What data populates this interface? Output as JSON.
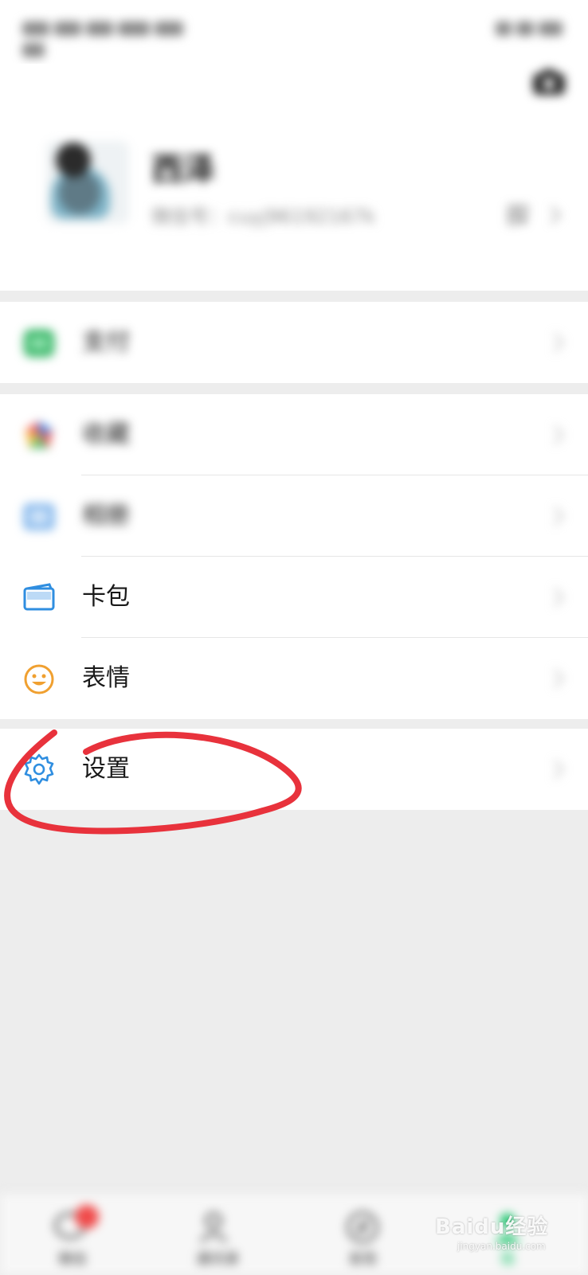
{
  "profile": {
    "nickname": "西泽",
    "wechat_id": "微信号：cuyj96192167k"
  },
  "menu": {
    "pay": {
      "label": "支付",
      "icon": "pay-icon"
    },
    "favorites": {
      "label": "收藏",
      "icon": "favorites-icon"
    },
    "moments": {
      "label": "相册",
      "icon": "album-icon"
    },
    "cards": {
      "label": "卡包",
      "icon": "card-wallet-icon"
    },
    "stickers": {
      "label": "表情",
      "icon": "smiley-icon"
    },
    "settings": {
      "label": "设置",
      "icon": "gear-icon"
    }
  },
  "tabbar": {
    "tabs": [
      {
        "label": "微信",
        "icon": "chat-icon",
        "badge": true
      },
      {
        "label": "通讯录",
        "icon": "contacts-icon"
      },
      {
        "label": "发现",
        "icon": "discover-icon"
      },
      {
        "label": "我",
        "icon": "me-icon",
        "active": true
      }
    ]
  },
  "watermark": {
    "main": "Baidu经验",
    "sub": "jingyan.baidu.com"
  },
  "colors": {
    "accent_green": "#07c160",
    "annotation_red": "#e8323c",
    "page_bg": "#ededed",
    "icon_blue": "#2f8ee0",
    "icon_orange": "#f0a030"
  }
}
